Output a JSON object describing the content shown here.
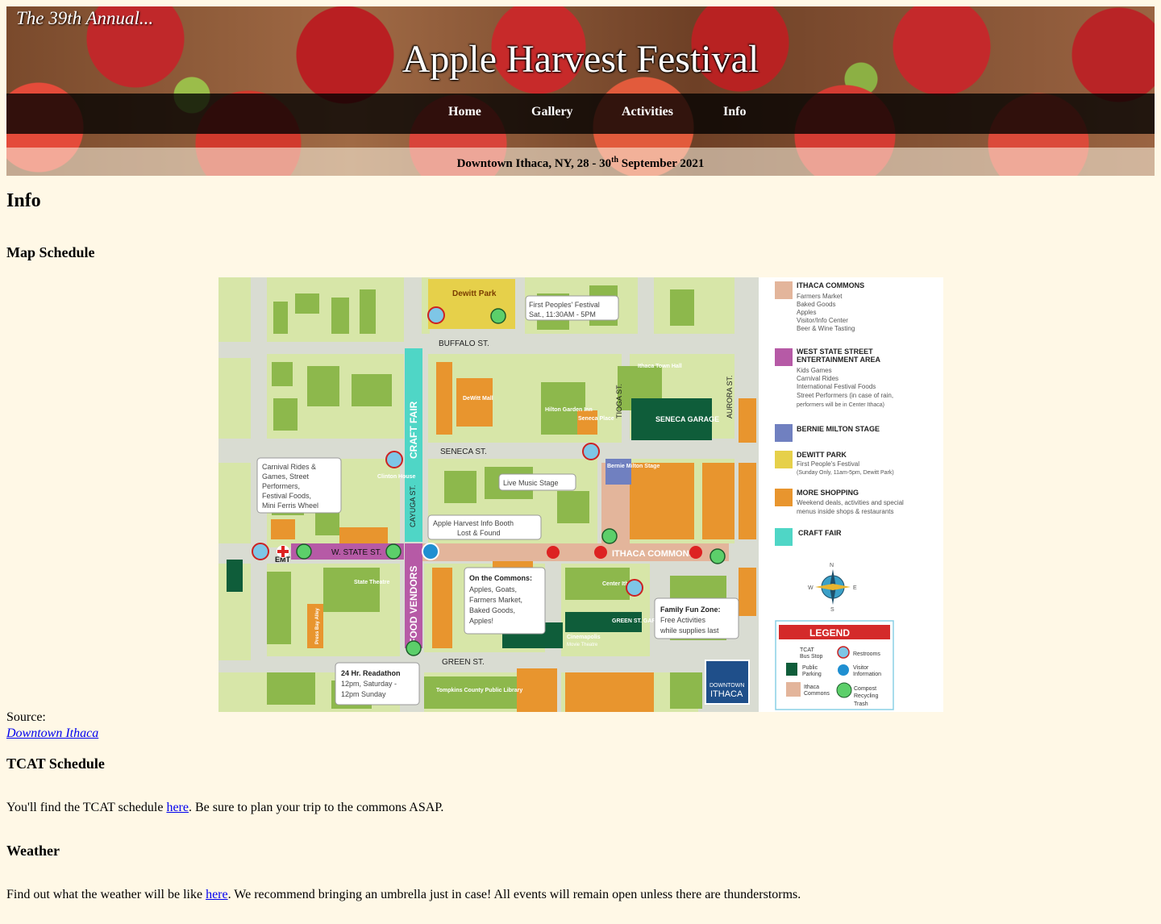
{
  "header": {
    "kicker": "The 39th Annual...",
    "title": "Apple Harvest Festival",
    "nav": [
      "Home",
      "Gallery",
      "Activities",
      "Info"
    ],
    "location_prefix": "Downtown Ithaca, NY, 28 - 30",
    "location_sup": "th",
    "location_suffix": " September 2021"
  },
  "page": {
    "title": "Info"
  },
  "map_section": {
    "heading": "Map Schedule",
    "source_label": "Source:",
    "source_link": "Downtown Ithaca",
    "map": {
      "streets": [
        "BUFFALO ST.",
        "SENECA ST.",
        "W. STATE ST.",
        "GREEN ST.",
        "CAYUGA ST.",
        "TIOGA ST.",
        "AURORA ST."
      ],
      "vertical_bands": [
        "CRAFT FAIR",
        "FOOD VENDORS"
      ],
      "places": [
        "Dewitt Park",
        "DeWitt Mall",
        "Hilton Garden Inn",
        "Seneca Place",
        "Ithaca Town Hall",
        "SENECA GARAGE",
        "Clinton House",
        "Bernie Milton Stage",
        "ITHACA COMMONS",
        "State Theatre",
        "Press Bay Alley",
        "Center Ithaca",
        "GREEN ST. GARAGE",
        "Cinemapolis",
        "Movie Theatre",
        "Tompkins County Public Library",
        "EMT"
      ],
      "callouts": {
        "first_peoples": [
          "First Peoples' Festival",
          "Sat., 11:30AM - 5PM"
        ],
        "carnival": [
          "Carnival Rides &",
          "Games, Street",
          "Performers,",
          "Festival Foods,",
          "Mini Ferris Wheel"
        ],
        "music": [
          "Live Music Stage"
        ],
        "info_booth": [
          "Apple Harvest Info Booth",
          "Lost & Found"
        ],
        "commons_title": "On the Commons:",
        "commons": [
          "Apples, Goats,",
          "Farmers Market,",
          "Baked Goods,",
          "Apples!"
        ],
        "family_title": "Family Fun Zone:",
        "family": [
          "Free Activities",
          "while supplies last"
        ],
        "readathon_title": "24 Hr. Readathon",
        "readathon": [
          "12pm, Saturday -",
          "12pm Sunday"
        ]
      },
      "apple_label": "Apples!",
      "badge": [
        "DOWNTOWN",
        "ITHACA"
      ],
      "legend_key": [
        {
          "title": "ITHACA COMMONS",
          "lines": [
            "Farmers Market",
            "Baked Goods",
            "Apples",
            "Visitor/Info Center",
            "Beer & Wine Tasting"
          ],
          "color": "#e3b59b"
        },
        {
          "title": "WEST STATE STREET",
          "title2": "ENTERTAINMENT AREA",
          "lines": [
            "Kids Games",
            "Carnival Rides",
            "International Festival Foods",
            "Street Performers (in case of rain,",
            "performers will be in Center Ithaca)"
          ],
          "color": "#b65aa6"
        },
        {
          "title": "BERNIE MILTON STAGE",
          "lines": [],
          "color": "#7080c0"
        },
        {
          "title": "DEWITT PARK",
          "lines": [
            "First People's Festival",
            "(Sunday Only, 11am-5pm, Dewitt Park)"
          ],
          "color": "#e6d04a"
        },
        {
          "title": "MORE SHOPPING",
          "lines": [
            "Weekend deals, activities and special",
            "menus inside shops & restaurants"
          ],
          "color": "#e8952e"
        },
        {
          "title": "CRAFT FAIR",
          "lines": [],
          "color": "#4fd6c6"
        }
      ],
      "compass": [
        "N",
        "E",
        "S",
        "W"
      ],
      "legend_box": {
        "title": "LEGEND",
        "items": [
          [
            "TCAT",
            "Bus Stop"
          ],
          [
            "Restrooms"
          ],
          [
            "Public",
            "Parking"
          ],
          [
            "Visitor",
            "Information"
          ],
          [
            "Ithaca",
            "Commons"
          ],
          [
            "Compost",
            "Recycling",
            "Trash"
          ]
        ]
      }
    }
  },
  "tcat": {
    "heading": "TCAT Schedule",
    "before": "You'll find the TCAT schedule ",
    "link": "here",
    "after": ". Be sure to plan your trip to the commons ASAP."
  },
  "weather": {
    "heading": "Weather",
    "before": "Find out what the weather will be like ",
    "link": "here",
    "after": ". We recommend bringing an umbrella just in case! All events will remain open unless there are thunderstorms."
  }
}
